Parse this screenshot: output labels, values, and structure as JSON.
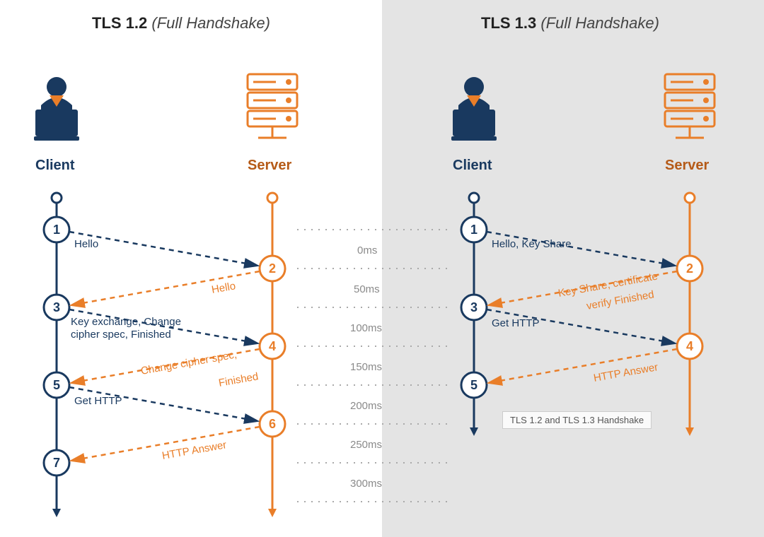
{
  "left": {
    "title_strong": "TLS 1.2",
    "title_sub": "(Full Handshake)",
    "role_client": "Client",
    "role_server": "Server",
    "steps": {
      "1": "1",
      "2": "2",
      "3": "3",
      "4": "4",
      "5": "5",
      "6": "6",
      "7": "7"
    },
    "messages": {
      "m1": "Hello",
      "m2": "Hello",
      "m3a": "Key exchange, Change",
      "m3b": "cipher spec, Finished",
      "m4a": "Change cipher spec,",
      "m4b": "Finished",
      "m5": "Get HTTP",
      "m6": "HTTP Answer"
    }
  },
  "right": {
    "title_strong": "TLS 1.3",
    "title_sub": "(Full Handshake)",
    "role_client": "Client",
    "role_server": "Server",
    "steps": {
      "1": "1",
      "2": "2",
      "3": "3",
      "4": "4",
      "5": "5"
    },
    "messages": {
      "m1": "Hello, Key Share",
      "m2a": "Key Share, certificate",
      "m2b": "verify  Finished",
      "m3": "Get HTTP",
      "m4": "HTTP Answer"
    }
  },
  "time": {
    "t0": "0ms",
    "t1": "50ms",
    "t2": "100ms",
    "t3": "150ms",
    "t4": "200ms",
    "t5": "250ms",
    "t6": "300ms"
  },
  "tooltip": "TLS 1.2 and TLS 1.3 Handshake",
  "colors": {
    "blue": "#19395f",
    "orange": "#e97e29",
    "grey": "#8a8a8a"
  }
}
